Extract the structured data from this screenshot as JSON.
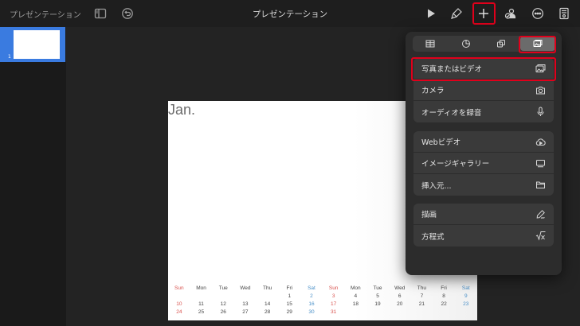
{
  "app": {
    "doc_name": "プレゼンテーション",
    "title": "プレゼンテーション"
  },
  "slide": {
    "number": "1",
    "title": "Jan.",
    "calendar": {
      "weekdays": [
        "Sun",
        "Mon",
        "Tue",
        "Wed",
        "Thu",
        "Fri",
        "Sat",
        "Sun",
        "Mon",
        "Tue",
        "Wed",
        "Thu",
        "Fri",
        "Sat"
      ],
      "rows": [
        [
          "",
          "",
          "",
          "",
          "",
          "1",
          "2",
          "3",
          "4",
          "5",
          "6",
          "7",
          "8",
          "9"
        ],
        [
          "10",
          "11",
          "12",
          "13",
          "14",
          "15",
          "16",
          "17",
          "18",
          "19",
          "20",
          "21",
          "22",
          "23"
        ],
        [
          "24",
          "25",
          "26",
          "27",
          "28",
          "29",
          "30",
          "31",
          "",
          "",
          "",
          "",
          "",
          ""
        ]
      ]
    }
  },
  "insert_menu": {
    "tabs": [
      "table-icon",
      "chart-icon",
      "shape-icon",
      "media-icon"
    ],
    "group1": [
      {
        "label": "写真またはビデオ",
        "icon": "photo-icon"
      },
      {
        "label": "カメラ",
        "icon": "camera-icon"
      },
      {
        "label": "オーディオを録音",
        "icon": "microphone-icon"
      }
    ],
    "group2": [
      {
        "label": "Webビデオ",
        "icon": "cloud-play-icon"
      },
      {
        "label": "イメージギャラリー",
        "icon": "gallery-icon"
      },
      {
        "label": "挿入元...",
        "icon": "folder-icon"
      }
    ],
    "group3": [
      {
        "label": "描画",
        "icon": "pen-icon"
      },
      {
        "label": "方程式",
        "icon": "equation-icon"
      }
    ]
  },
  "colors": {
    "highlight": "#e0001b",
    "sidebar_selected": "#3a7be0"
  }
}
